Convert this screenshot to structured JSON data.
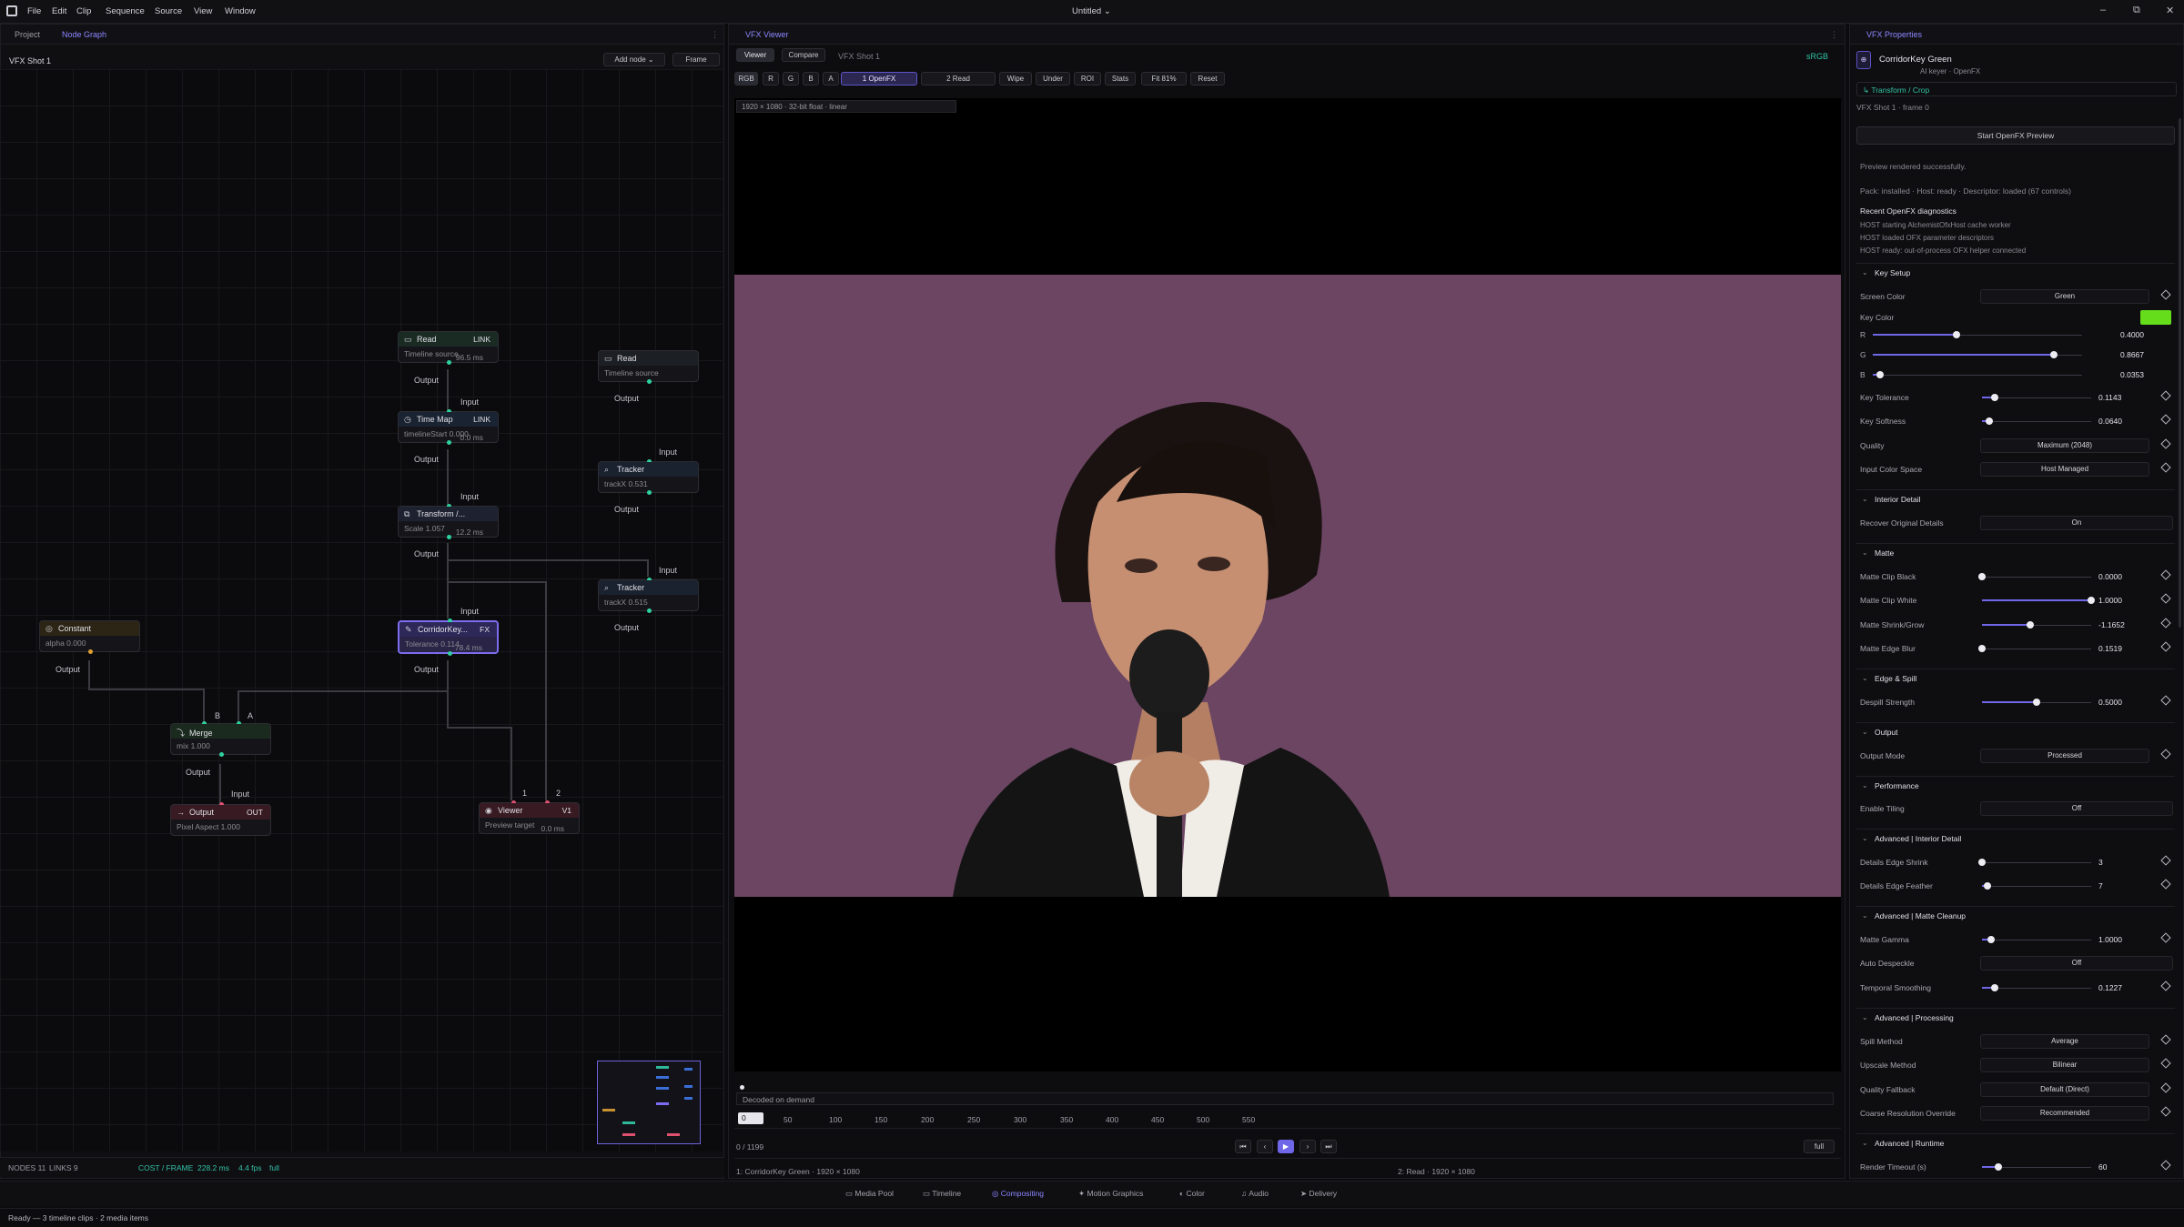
{
  "menubar": {
    "items": [
      "File",
      "Edit",
      "Clip",
      "Sequence",
      "Source",
      "View",
      "Window"
    ],
    "title": "Untitled"
  },
  "left_panel": {
    "tabs": [
      "Project",
      "Node Graph"
    ],
    "graph_title": "VFX Shot 1",
    "add_node": "Add node",
    "frame_btn": "Frame",
    "status": {
      "nodes": "NODES 11",
      "links": "LINKS 9",
      "cost": "COST / FRAME",
      "cost_val": "228.2 ms",
      "fps": "4.4 fps",
      "quality": "full"
    }
  },
  "nodes": {
    "read1": {
      "title": "Read",
      "tag": "LINK",
      "sub": "Timeline source",
      "ms": "96.5 ms",
      "out": "Output"
    },
    "read2": {
      "title": "Read",
      "sub": "Timeline source",
      "out": "Output"
    },
    "timemap": {
      "title": "Time Map",
      "tag": "LINK",
      "sub": "timelineStart 0.000",
      "ms": "0.0 ms",
      "in": "Input",
      "out": "Output"
    },
    "tracker1": {
      "title": "Tracker",
      "sub": "trackX 0.531",
      "in": "Input",
      "out": "Output"
    },
    "transform": {
      "title": "Transform /...",
      "sub": "Scale 1.057",
      "ms": "12.2 ms",
      "in": "Input",
      "out": "Output"
    },
    "tracker2": {
      "title": "Tracker",
      "sub": "trackX 0.515",
      "in": "Input",
      "out": "Output"
    },
    "corridor": {
      "title": "CorridorKey...",
      "tag": "FX",
      "sub": "Tolerance 0.114",
      "ms": "78.4 ms",
      "in": "Input",
      "out": "Output"
    },
    "constant": {
      "title": "Constant",
      "sub": "alpha 0.000",
      "out": "Output"
    },
    "merge": {
      "title": "Merge",
      "sub": "mix 1.000",
      "in_b": "B",
      "in_a": "A",
      "out": "Output"
    },
    "output": {
      "title": "Output",
      "tag": "OUT",
      "sub": "Pixel Aspect 1.000",
      "in": "Input"
    },
    "viewer": {
      "title": "Viewer",
      "tag": "V1",
      "sub": "Preview target",
      "ms": "0.0 ms",
      "in1": "1",
      "in2": "2"
    }
  },
  "viewer": {
    "panel_title": "VFX Viewer",
    "tabs": [
      "Viewer",
      "Compare"
    ],
    "shot": "VFX Shot 1",
    "colorspace": "sRGB",
    "toolbar": [
      "RGB",
      "R",
      "G",
      "B",
      "A",
      "1 OpenFX",
      "2 Read",
      "Wipe",
      "Under",
      "ROI",
      "Stats",
      "Fit 81%",
      "Reset"
    ],
    "info": "1920 × 1080 · 32-bit float · linear",
    "decoded": "Decoded on demand",
    "frame_input": "0",
    "ruler": [
      "50",
      "100",
      "150",
      "200",
      "250",
      "300",
      "350",
      "400",
      "450",
      "500",
      "550"
    ],
    "frame_count": "0 / 1199",
    "quality": "full",
    "footer_left": "1: CorridorKey Green · 1920 × 1080",
    "footer_right": "2: Read · 1920 × 1080"
  },
  "properties": {
    "panel_title": "VFX Properties",
    "node_name": "CorridorKey Green",
    "node_sub": "AI keyer · OpenFX",
    "link": "↳ Transform / Crop",
    "frame_label": "VFX Shot 1 · frame 0",
    "preview_btn": "Start OpenFX Preview",
    "preview_msg": "Preview rendered successfully.",
    "pack_msg": "Pack: installed · Host: ready · Descriptor: loaded (67 controls)",
    "diag_title": "Recent OpenFX diagnostics",
    "diag": [
      "HOST starting AlchemistOfxHost cache worker",
      "HOST loaded OFX parameter descriptors",
      "HOST ready: out-of-process OFX helper connected"
    ],
    "sections": {
      "key_setup": "Key Setup",
      "interior": "Interior Detail",
      "matte": "Matte",
      "edge": "Edge & Spill",
      "output": "Output",
      "performance": "Performance",
      "adv_interior": "Advanced | Interior Detail",
      "adv_matte": "Advanced | Matte Cleanup",
      "adv_proc": "Advanced | Processing",
      "adv_runtime": "Advanced | Runtime"
    },
    "key_color_hex": "#66dd1b",
    "rows": {
      "screen_color": {
        "label": "Screen Color",
        "value": "Green"
      },
      "key_color": {
        "label": "Key Color"
      },
      "r": {
        "label": "R",
        "value": "0.4000",
        "frac": 0.4
      },
      "g": {
        "label": "G",
        "value": "0.8667",
        "frac": 0.8667
      },
      "b": {
        "label": "B",
        "value": "0.0353",
        "frac": 0.0353
      },
      "key_tol": {
        "label": "Key Tolerance",
        "value": "0.1143",
        "frac": 0.1143
      },
      "key_soft": {
        "label": "Key Softness",
        "value": "0.0640",
        "frac": 0.064
      },
      "quality": {
        "label": "Quality",
        "value": "Maximum (2048)"
      },
      "input_cs": {
        "label": "Input Color Space",
        "value": "Host Managed"
      },
      "recover": {
        "label": "Recover Original Details",
        "value": "On"
      },
      "clip_black": {
        "label": "Matte Clip Black",
        "value": "0.0000",
        "frac": 0
      },
      "clip_white": {
        "label": "Matte Clip White",
        "value": "1.0000",
        "frac": 1
      },
      "shrink_grow": {
        "label": "Matte Shrink/Grow",
        "value": "-1.1652",
        "frac": 0.44
      },
      "edge_blur": {
        "label": "Matte Edge Blur",
        "value": "0.1519",
        "frac": 0.0
      },
      "despill": {
        "label": "Despill Strength",
        "value": "0.5000",
        "frac": 0.5
      },
      "output_mode": {
        "label": "Output Mode",
        "value": "Processed"
      },
      "tiling": {
        "label": "Enable Tiling",
        "value": "Off"
      },
      "det_shrink": {
        "label": "Details Edge Shrink",
        "value": "3",
        "frac": 0.0
      },
      "det_feather": {
        "label": "Details Edge Feather",
        "value": "7",
        "frac": 0.05
      },
      "gamma": {
        "label": "Matte Gamma",
        "value": "1.0000",
        "frac": 0.08
      },
      "despeckle": {
        "label": "Auto Despeckle",
        "value": "Off"
      },
      "temporal": {
        "label": "Temporal Smoothing",
        "value": "0.1227",
        "frac": 0.12
      },
      "spill_method": {
        "label": "Spill Method",
        "value": "Average"
      },
      "upscale": {
        "label": "Upscale Method",
        "value": "Bilinear"
      },
      "fallback": {
        "label": "Quality Fallback",
        "value": "Default (Direct)"
      },
      "coarse": {
        "label": "Coarse Resolution Override",
        "value": "Recommended"
      },
      "render_timeout": {
        "label": "Render Timeout (s)",
        "value": "60",
        "frac": 0.15
      }
    }
  },
  "workspace_tabs": [
    "Media Pool",
    "Timeline",
    "Compositing",
    "Motion Graphics",
    "Color",
    "Audio",
    "Delivery"
  ],
  "statusbar": "Ready — 3 timeline clips · 2 media items"
}
